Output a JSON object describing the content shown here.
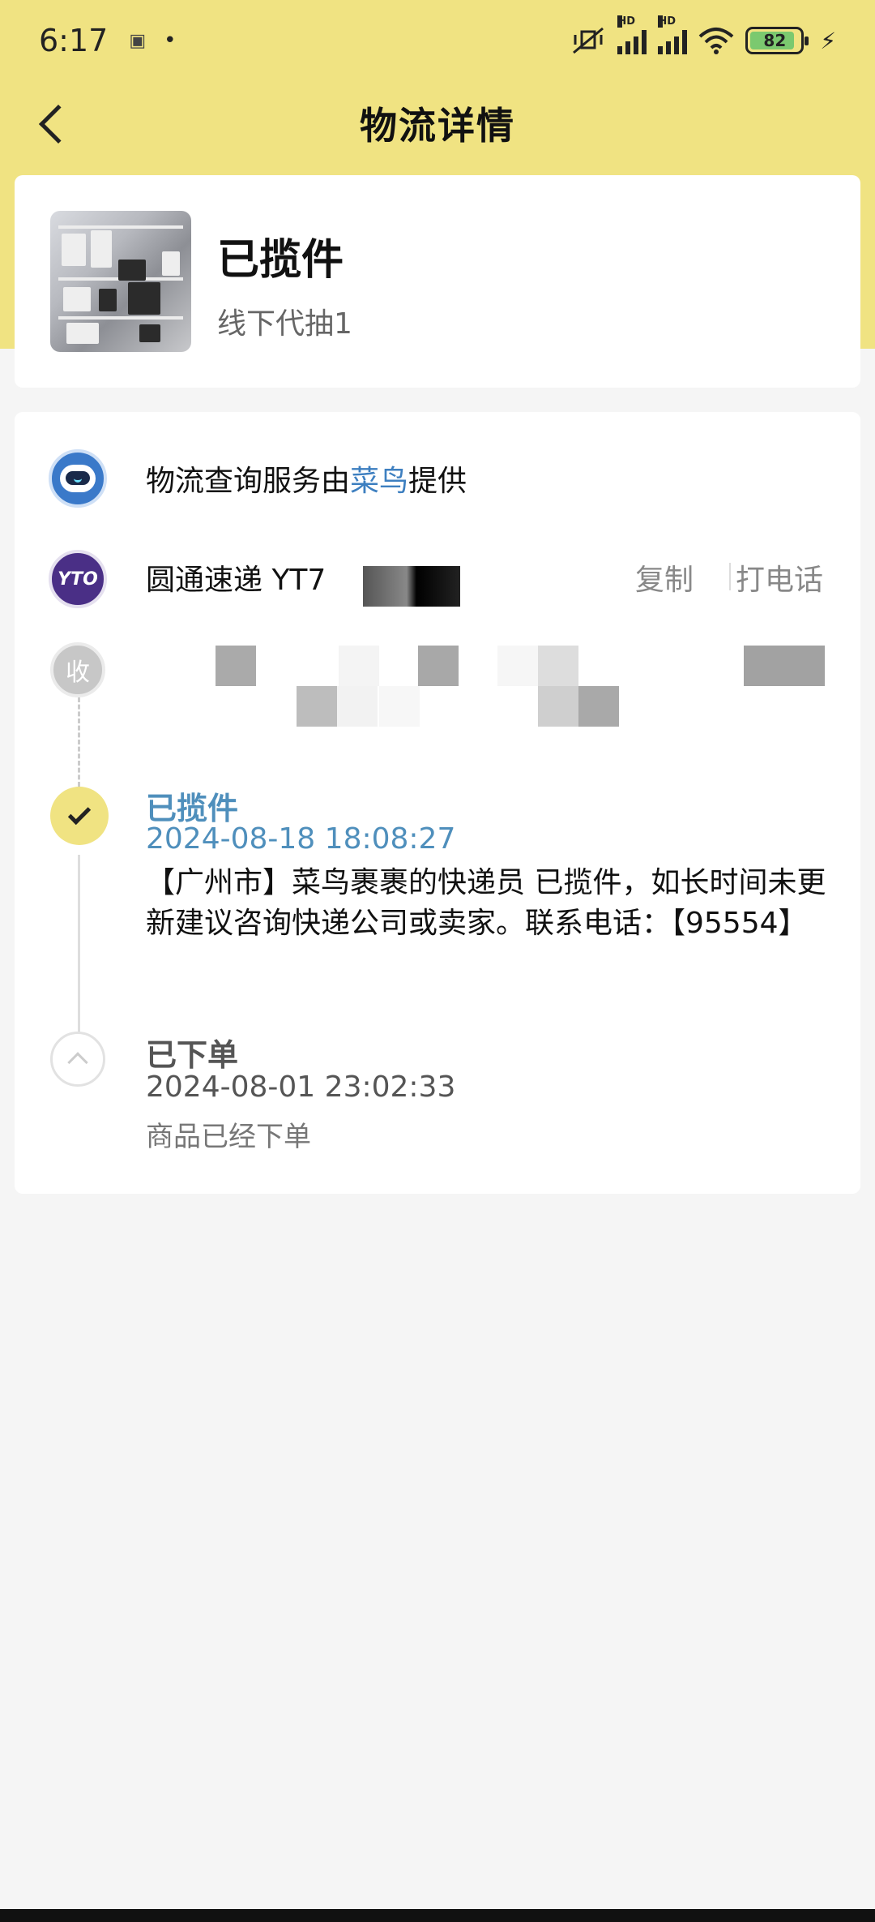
{
  "status_bar": {
    "time": "6:17",
    "extra": "•",
    "battery": "82",
    "hd1": "HD",
    "hd2": "HD"
  },
  "header": {
    "title": "物流详情"
  },
  "product": {
    "status": "已揽件",
    "name": "线下代抽1"
  },
  "logistics": {
    "provider_prefix": "物流查询服务由",
    "provider_name": "菜鸟",
    "provider_suffix": "提供",
    "carrier": "圆通速递 YT7",
    "copy_label": "复制",
    "call_label": "打电话",
    "receiver_badge": "收",
    "carrier_logo": "YTO"
  },
  "events": [
    {
      "title": "已揽件",
      "time": "2024-08-18 18:08:27",
      "desc": "【广州市】菜鸟裹裹的快递员                  已揽件，如长时间未更新建议咨询快递公司或卖家。联系电话：【95554】"
    },
    {
      "title": "已下单",
      "time": "2024-08-01 23:02:33",
      "desc": "商品已经下单"
    }
  ],
  "colors": {
    "header_bg": "#f0e382",
    "accent_blue": "#4f8fbc",
    "page_bg": "#f5f5f5"
  },
  "icons": [
    "back-icon",
    "cainiao-logo-icon",
    "yto-logo-icon",
    "check-icon",
    "chevron-up-icon",
    "wifi-icon",
    "battery-icon",
    "signal-icon"
  ]
}
